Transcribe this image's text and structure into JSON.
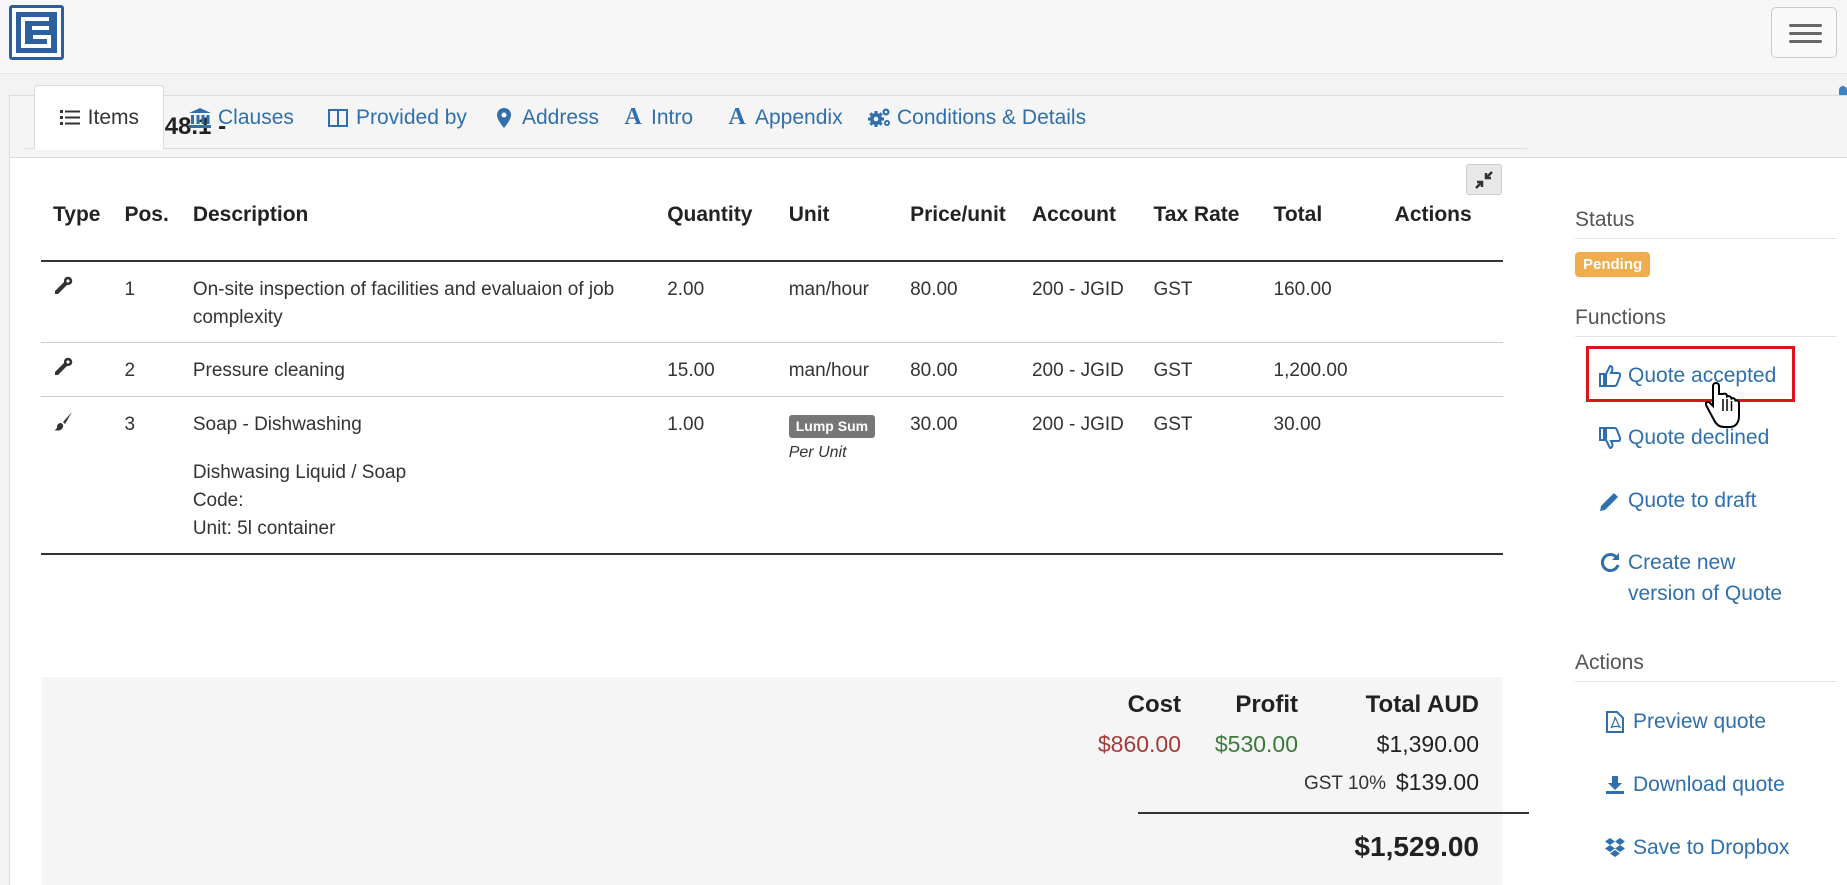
{
  "header": {
    "logo_icon": "company-logo",
    "menu_icon": "hamburger-icon"
  },
  "panel": {
    "title": "Quote 1048.1 -",
    "title_icon": "document-icon"
  },
  "tabs": [
    {
      "label": "Items",
      "icon": "list-icon",
      "active": true
    },
    {
      "label": "Clauses",
      "icon": "bank-icon"
    },
    {
      "label": "Provided by",
      "icon": "columns-icon"
    },
    {
      "label": "Address",
      "icon": "map-marker-icon"
    },
    {
      "label": "Intro",
      "icon": "font-icon"
    },
    {
      "label": "Appendix",
      "icon": "font-icon"
    },
    {
      "label": "Conditions & Details",
      "icon": "cogs-icon"
    }
  ],
  "table": {
    "headers": [
      "Type",
      "Pos.",
      "Description",
      "Quantity",
      "Unit",
      "Price/unit",
      "Account",
      "Tax Rate",
      "Total",
      "Actions"
    ],
    "rows": [
      {
        "type_icon": "wrench-icon",
        "pos": "1",
        "description": "On-site inspection of facilities and evaluaion of job complexity",
        "quantity": "2.00",
        "unit": "man/hour",
        "price": "80.00",
        "account": "200 - JGID",
        "tax": "GST",
        "total": "160.00"
      },
      {
        "type_icon": "wrench-icon",
        "pos": "2",
        "description": "Pressure cleaning",
        "quantity": "15.00",
        "unit": "man/hour",
        "price": "80.00",
        "account": "200 - JGID",
        "tax": "GST",
        "total": "1,200.00"
      },
      {
        "type_icon": "paintbrush-icon",
        "pos": "3",
        "description": "Soap - Dishwashing",
        "desc_line2": "Dishwasing Liquid / Soap",
        "desc_line3": "Code:",
        "desc_line4": "Unit: 5l container",
        "quantity": "1.00",
        "unit_badge": "Lump Sum",
        "unit_sub": "Per Unit",
        "price": "30.00",
        "account": "200 - JGID",
        "tax": "GST",
        "total": "30.00"
      }
    ]
  },
  "summary": {
    "cost_label": "Cost",
    "profit_label": "Profit",
    "total_label": "Total AUD",
    "cost": "$860.00",
    "profit": "$530.00",
    "total": "$1,390.00",
    "gst_label": "GST 10%",
    "gst": "$139.00",
    "grand_total": "$1,529.00",
    "cost_color": "#a33b3b",
    "profit_color": "#3a7a3a"
  },
  "sidebar": {
    "status_heading": "Status",
    "status_badge": "Pending",
    "functions_heading": "Functions",
    "functions": [
      {
        "label": "Quote accepted",
        "icon": "thumbs-up-icon"
      },
      {
        "label": "Quote declined",
        "icon": "thumbs-down-icon"
      },
      {
        "label": "Quote to draft",
        "icon": "pencil-icon"
      },
      {
        "label": "Create new version of Quote",
        "icon": "refresh-icon"
      }
    ],
    "actions_heading": "Actions",
    "actions": [
      {
        "label": "Preview quote",
        "icon": "file-pdf-icon"
      },
      {
        "label": "Download quote",
        "icon": "download-icon"
      },
      {
        "label": "Save to Dropbox",
        "icon": "dropbox-icon"
      }
    ]
  }
}
